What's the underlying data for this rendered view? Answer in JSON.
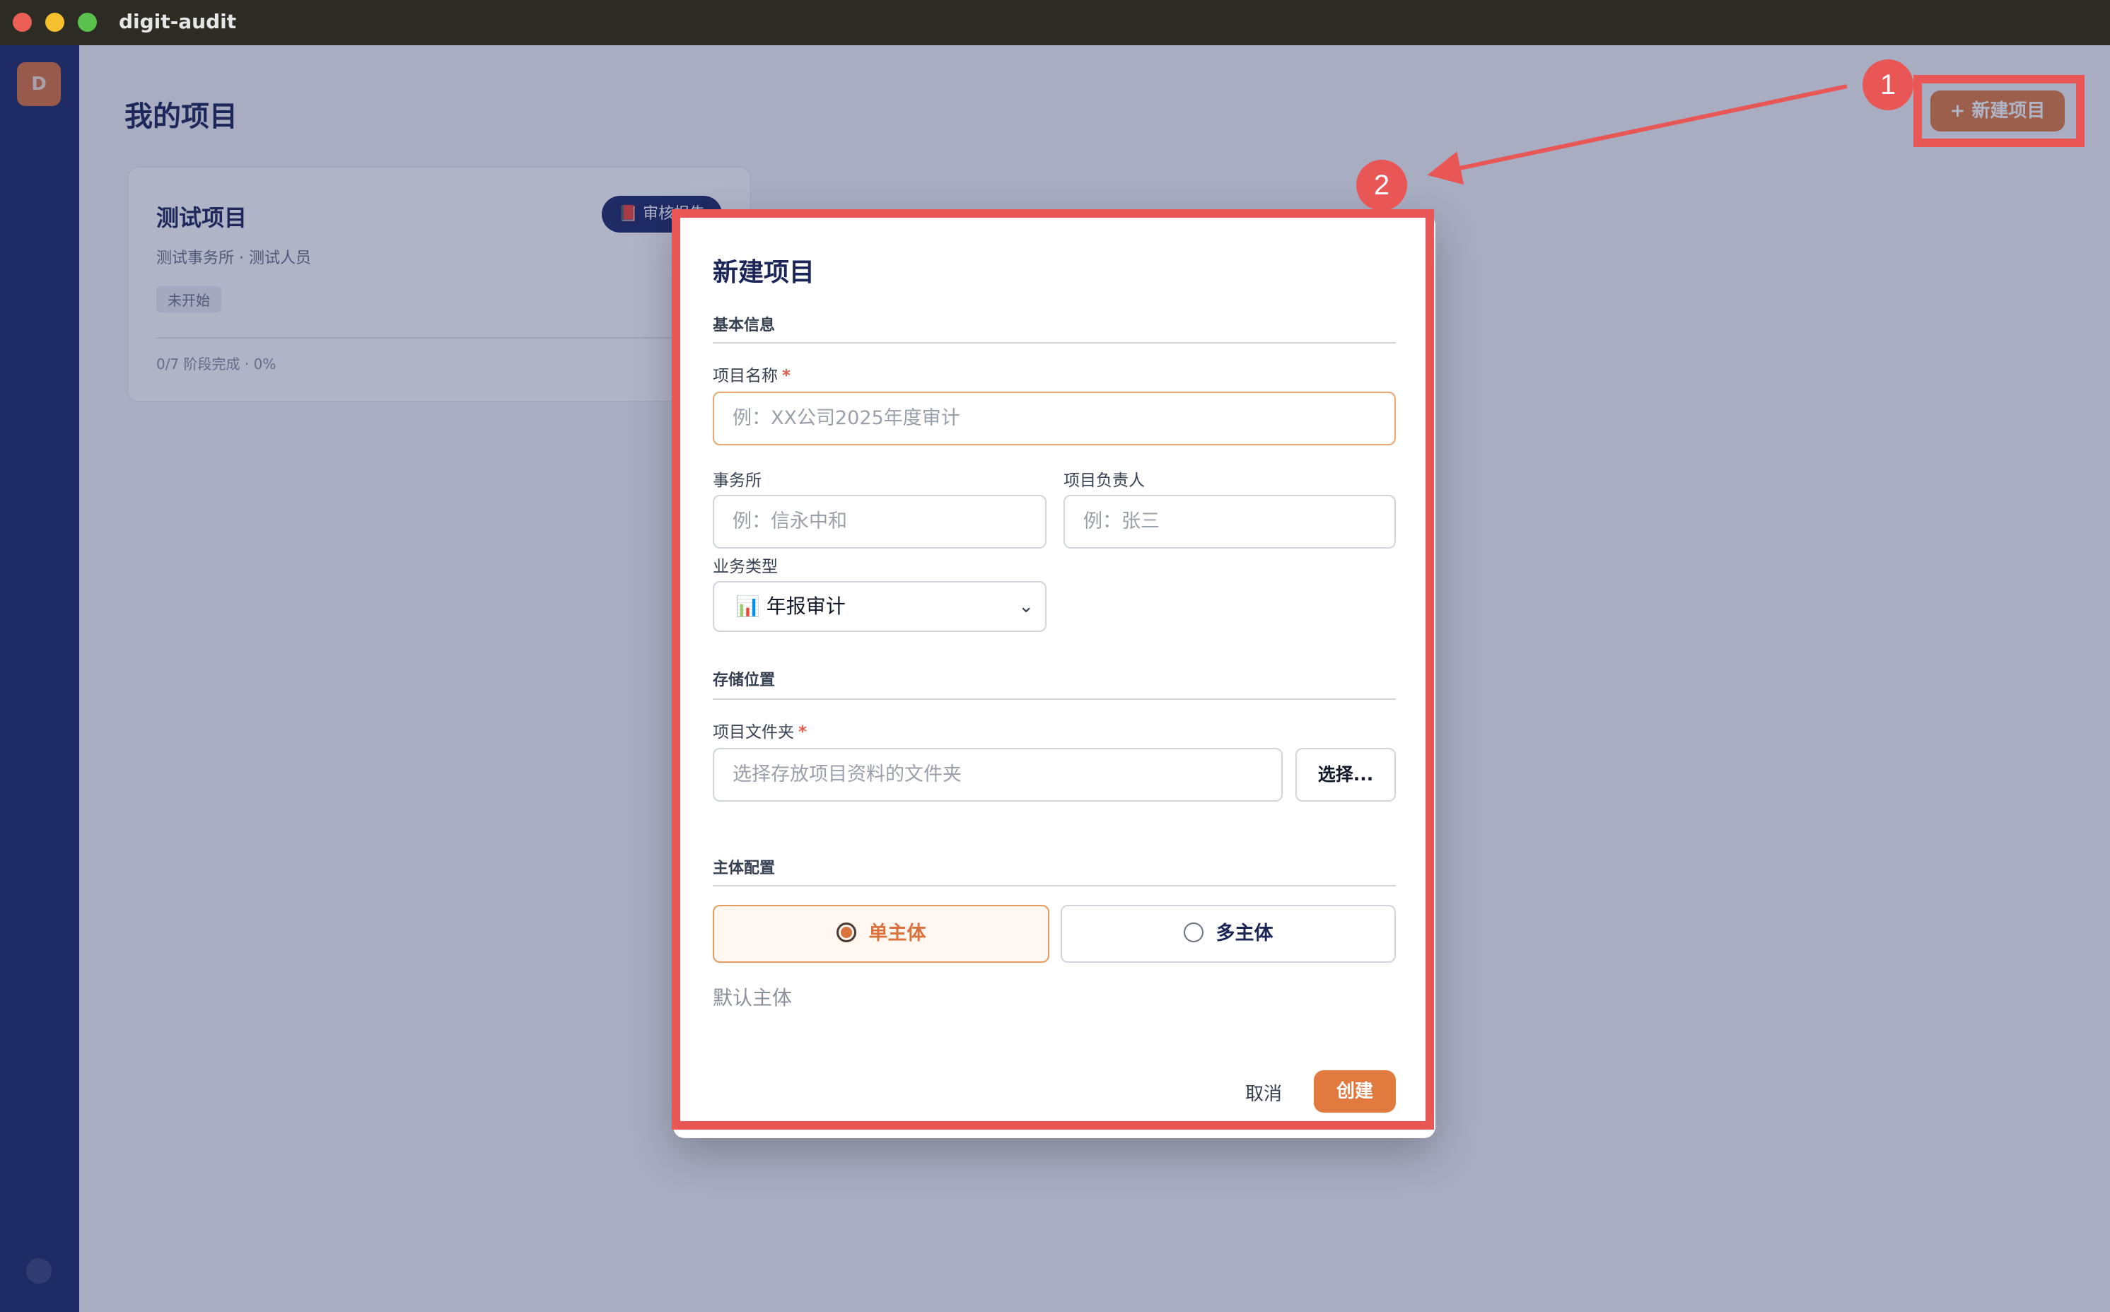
{
  "window": {
    "title": "digit-audit",
    "traffic_colors": [
      "#ec5f57",
      "#f6bf2e",
      "#5ac24c"
    ]
  },
  "sidebar": {
    "logo_letter": "D"
  },
  "page": {
    "title": "我的项目",
    "new_button": "+ 新建项目"
  },
  "project_card": {
    "title": "测试项目",
    "subtitle": "测试事务所 · 测试人员",
    "status": "未开始",
    "action": "📕 审核报告",
    "progress": "0/7 阶段完成 · 0%"
  },
  "modal": {
    "title": "新建项目",
    "basic_section": "基本信息",
    "name_label": "项目名称",
    "required_mark": "*",
    "name_placeholder": "例：XX公司2025年度审计",
    "firm_label": "事务所",
    "firm_placeholder": "例：信永中和",
    "lead_label": "项目负责人",
    "lead_placeholder": "例：张三",
    "type_label": "业务类型",
    "type_value": "📊 年报审计",
    "storage_section": "存储位置",
    "folder_label": "项目文件夹",
    "folder_placeholder": "选择存放项目资料的文件夹",
    "choose_button": "选择...",
    "entity_section": "主体配置",
    "single_entity": "单主体",
    "multi_entity": "多主体",
    "default_entity": "默认主体",
    "cancel": "取消",
    "create": "创建"
  },
  "annotations": {
    "badge1": "1",
    "badge2": "2",
    "color": "#e85656"
  }
}
